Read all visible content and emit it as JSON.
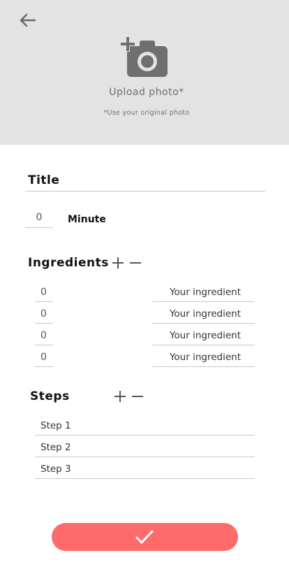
{
  "header": {
    "upload_label": "Upload photo*",
    "upload_hint": "*Use your original photo"
  },
  "form": {
    "title_label": "Title",
    "minute_value": "0",
    "minute_label": "Minute"
  },
  "ingredients": {
    "title": "Ingredients",
    "rows": [
      {
        "qty": "0",
        "name": "Your ingredient"
      },
      {
        "qty": "0",
        "name": "Your ingredient"
      },
      {
        "qty": "0",
        "name": "Your ingredient"
      },
      {
        "qty": "0",
        "name": "Your ingredient"
      }
    ]
  },
  "steps": {
    "title": "Steps",
    "items": [
      "Step 1",
      "Step 2",
      "Step 3"
    ]
  },
  "colors": {
    "accent": "#ff6b6b",
    "header_bg": "#e3e3e3",
    "icon_gray": "#6f6f6f"
  },
  "icons": {
    "back": "arrow-left-icon",
    "camera": "add-photo-icon",
    "plus": "plus-icon",
    "minus": "minus-icon",
    "submit": "checkmark-icon"
  }
}
